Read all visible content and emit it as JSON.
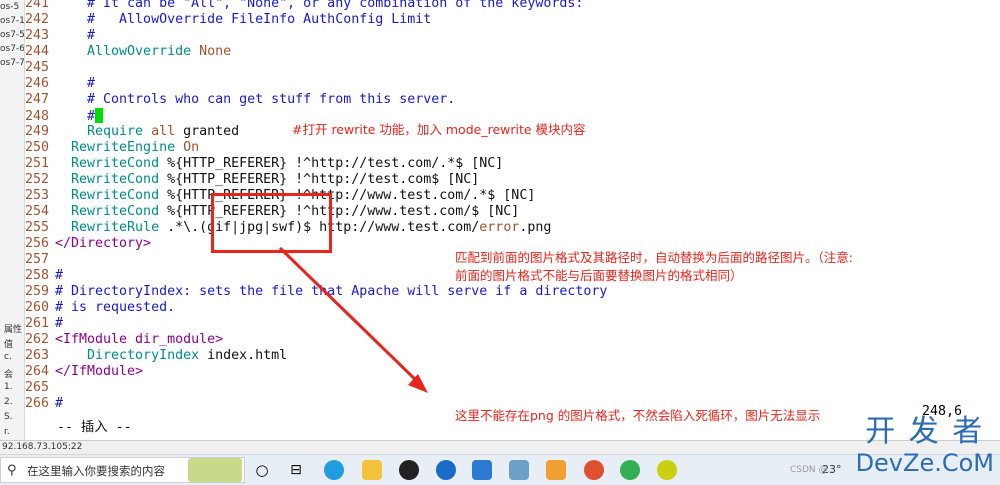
{
  "sidebar": {
    "items": [
      "os-5",
      "os7-1",
      "os7-5",
      "os7-6",
      "os7-7"
    ],
    "lower": [
      "属性",
      "值",
      "c.",
      "会",
      "1.",
      "2.",
      "S.",
      "r."
    ]
  },
  "editor": {
    "lines": [
      {
        "n": "241",
        "parts": [
          {
            "c": "cm",
            "t": "    # It can be \"All\", \"None\", or any combination of the keywords:"
          }
        ]
      },
      {
        "n": "242",
        "parts": [
          {
            "c": "cm",
            "t": "    #   AllowOverride FileInfo AuthConfig Limit"
          }
        ]
      },
      {
        "n": "243",
        "parts": [
          {
            "c": "cm",
            "t": "    #"
          }
        ]
      },
      {
        "n": "244",
        "parts": [
          {
            "c": "kw",
            "t": "    AllowOverride "
          },
          {
            "c": "st",
            "t": "None"
          }
        ]
      },
      {
        "n": "245",
        "parts": []
      },
      {
        "n": "246",
        "parts": [
          {
            "c": "cm",
            "t": "    #"
          }
        ]
      },
      {
        "n": "247",
        "parts": [
          {
            "c": "cm",
            "t": "    # Controls who can get stuff from this server."
          }
        ]
      },
      {
        "n": "248",
        "parts": [
          {
            "c": "cm",
            "t": "    #"
          }
        ],
        "cursor": true
      },
      {
        "n": "249",
        "parts": [
          {
            "c": "kw",
            "t": "    Require "
          },
          {
            "c": "st",
            "t": "all "
          },
          {
            "c": "tx",
            "t": "granted"
          }
        ]
      },
      {
        "n": "250",
        "parts": [
          {
            "c": "kw",
            "t": "  RewriteEngine "
          },
          {
            "c": "st",
            "t": "On"
          }
        ]
      },
      {
        "n": "251",
        "parts": [
          {
            "c": "kw",
            "t": "  RewriteCond "
          },
          {
            "c": "tx",
            "t": "%{HTTP_REFERER} !^http://test.com/.*$ [NC]"
          }
        ]
      },
      {
        "n": "252",
        "parts": [
          {
            "c": "kw",
            "t": "  RewriteCond "
          },
          {
            "c": "tx",
            "t": "%{HTTP_REFERER} !^http://test.com$ [NC]"
          }
        ]
      },
      {
        "n": "253",
        "parts": [
          {
            "c": "kw",
            "t": "  RewriteCond "
          },
          {
            "c": "tx",
            "t": "%{HTTP_REFERER} !^http://www.test.com/.*$ [NC]"
          }
        ]
      },
      {
        "n": "254",
        "parts": [
          {
            "c": "kw",
            "t": "  RewriteCond "
          },
          {
            "c": "tx",
            "t": "%{HTTP_REFERER} !^http://www.test.com/$ [NC]"
          }
        ]
      },
      {
        "n": "255",
        "parts": [
          {
            "c": "kw",
            "t": "  RewriteRule "
          },
          {
            "c": "tx",
            "t": ".*\\.(gif|jpg|swf)$ http://www.test.com/"
          },
          {
            "c": "st",
            "t": "error"
          },
          {
            "c": "tx",
            "t": ".png"
          }
        ]
      },
      {
        "n": "256",
        "parts": [
          {
            "c": "tg",
            "t": "</Directory>"
          }
        ]
      },
      {
        "n": "257",
        "parts": []
      },
      {
        "n": "258",
        "parts": [
          {
            "c": "cm",
            "t": "#"
          }
        ]
      },
      {
        "n": "259",
        "parts": [
          {
            "c": "cm",
            "t": "# DirectoryIndex: sets the file that Apache will serve if a directory"
          }
        ]
      },
      {
        "n": "260",
        "parts": [
          {
            "c": "cm",
            "t": "# is requested."
          }
        ]
      },
      {
        "n": "261",
        "parts": [
          {
            "c": "cm",
            "t": "#"
          }
        ]
      },
      {
        "n": "262",
        "parts": [
          {
            "c": "tg",
            "t": "<IfModule dir_module>"
          }
        ]
      },
      {
        "n": "263",
        "parts": [
          {
            "c": "kw",
            "t": "    DirectoryIndex "
          },
          {
            "c": "tx",
            "t": "index.html"
          }
        ]
      },
      {
        "n": "264",
        "parts": [
          {
            "c": "tg",
            "t": "</IfModule>"
          }
        ]
      },
      {
        "n": "265",
        "parts": []
      },
      {
        "n": "266",
        "parts": [
          {
            "c": "cm",
            "t": "#"
          }
        ]
      }
    ],
    "mode": "-- 插入 --",
    "position": "248,6"
  },
  "annotations": {
    "a1": "#打开 rewrite 功能，加入 mode_rewrite 模块内容",
    "a2_line1": "匹配到前面的图片格式及其路径时，自动替换为后面的路径图片。（注意:",
    "a2_line2": "前面的图片格式不能与后面要替换图片的格式相同）",
    "a3": "这里不能存在png 的图片格式，不然会陷入死循环，图片无法显示"
  },
  "status": {
    "ip": "92.168.73.105:22"
  },
  "taskbar": {
    "search_placeholder": "在这里输入你要搜索的内容",
    "temp": "23°",
    "csdn": "CSDN @..."
  },
  "watermark": {
    "top": "开 发 者",
    "bottom": "DevZe.CoM"
  },
  "colors": {
    "annotation": "#e8241b",
    "comment": "#1a1ad0",
    "keyword": "#008b8b",
    "cursor": "#00e000"
  }
}
